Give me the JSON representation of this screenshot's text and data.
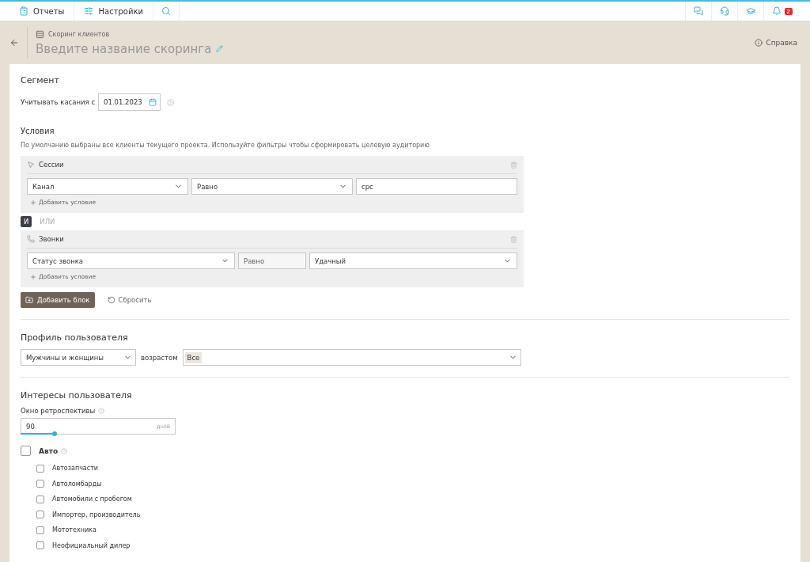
{
  "topbar": {
    "nav": [
      {
        "label": "Отчеты",
        "kind": "reports"
      },
      {
        "label": "Настройки",
        "kind": "settings"
      }
    ],
    "notifications_count": "2"
  },
  "header": {
    "breadcrumb": "Скоринг клиентов",
    "title": "Введите название скоринга",
    "help": "Справка"
  },
  "segment": {
    "title": "Сегмент",
    "touch_label": "Учитывать касания с",
    "touch_date": "01.01.2023"
  },
  "conditions": {
    "title": "Условия",
    "hint": "По умолчанию выбраны все клиенты текущего проекта. Используйте фильтры чтобы сформировать целевую аудиторию",
    "blocks": [
      {
        "title": "Сессии",
        "kind": "sessions",
        "add": "Добавить условие",
        "fields": [
          {
            "kind": "select",
            "value": "Канал"
          },
          {
            "kind": "select",
            "value": "Равно"
          },
          {
            "kind": "input",
            "value": "cpc"
          }
        ]
      },
      {
        "title": "Звонки",
        "kind": "calls",
        "add": "Добавить условие",
        "fields": [
          {
            "kind": "select",
            "value": "Статус звонка"
          },
          {
            "kind": "static",
            "value": "Равно"
          },
          {
            "kind": "select",
            "value": "Удачный"
          }
        ]
      }
    ],
    "logic": [
      {
        "label": "И",
        "selected": true
      },
      {
        "label": "ИЛИ",
        "selected": false
      }
    ],
    "add_block": "Добавить блок",
    "reset": "Сбросить"
  },
  "profile": {
    "title": "Профиль пользователя",
    "gender": "Мужчины и женщины",
    "age_label": "возрастом",
    "age_tag": "Все"
  },
  "interests": {
    "title": "Интересы пользователя",
    "window_label": "Окно ретроспективы",
    "window_value": "90",
    "window_unit": "дней",
    "level": 0.22,
    "groups": [
      {
        "label": "Авто",
        "checked": false,
        "children": [
          {
            "label": "Автозапчасти",
            "checked": false
          },
          {
            "label": "Автоломбарды",
            "checked": false
          },
          {
            "label": "Автомобили с пробегом",
            "checked": false
          },
          {
            "label": "Импортер, производитель",
            "checked": false
          },
          {
            "label": "Мототехника",
            "checked": false
          },
          {
            "label": "Неофициальный дилер",
            "checked": false
          }
        ]
      }
    ]
  }
}
